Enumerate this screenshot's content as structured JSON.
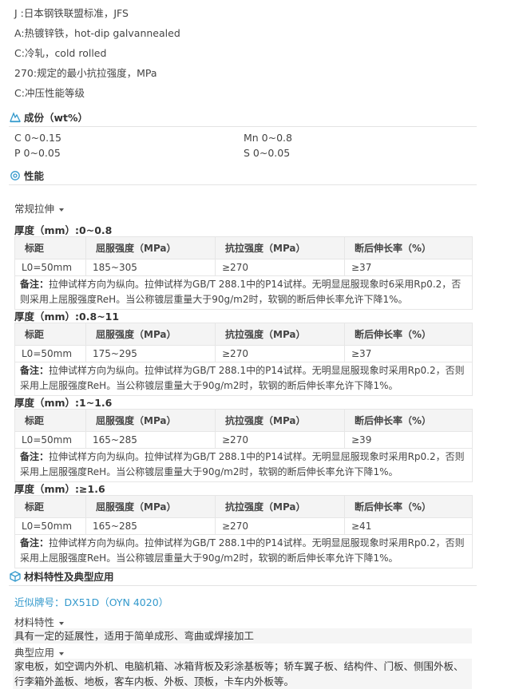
{
  "designation": [
    "J :日本钢铁联盟标准，JFS",
    "A:热镀锌铁，hot-dip galvannealed",
    "C:冷轧，cold rolled",
    "270:规定的最小抗拉强度，MPa",
    "C:冲压性能等级"
  ],
  "composition": {
    "title": "成份（wt%）",
    "items": [
      "C 0~0.15",
      "Mn 0~0.8",
      "P 0~0.05",
      "S 0~0.05"
    ]
  },
  "performance": {
    "title": "性能",
    "dropdown": "常规拉伸",
    "headers": [
      "标距",
      "屈服强度（MPa）",
      "抗拉强度（MPa）",
      "断后伸长率（%）"
    ],
    "note_label": "备注：",
    "note_text": "拉伸试样方向为纵向。拉伸试样为GB/T 288.1中的P14试样。无明显屈服现象时采用Rp0.2，否则采用上屈服强度ReH。当公称镀层重量大于90g/m2时，软钢的断后伸长率允许下降1%。",
    "groups": [
      {
        "thickness": "厚度（mm）:0~0.8",
        "row": [
          "L0=50mm",
          "185~305",
          "≥270",
          "≥37"
        ],
        "note_label": "备注：",
        "note_text": "拉伸试样方向为纵向。拉伸试样为GB/T 288.1中的P14试样。无明显屈服现象时6采用Rp0.2，否则采用上屈服强度ReH。当公称镀层重量大于90g/m2时，软钢的断后伸长率允许下降1%。"
      },
      {
        "thickness": "厚度（mm）:0.8~11",
        "row": [
          "L0=50mm",
          "175~295",
          "≥270",
          "≥37"
        ],
        "note_label": "备注：",
        "note_text": "拉伸试样方向为纵向。拉伸试样为GB/T 288.1中的P14试样。无明显屈服现象时采用Rp0.2，否则采用上屈服强度ReH。当公称镀层重量大于90g/m2时，软钢的断后伸长率允许下降1%。"
      },
      {
        "thickness": "厚度（mm）:1~1.6",
        "row": [
          "L0=50mm",
          "165~285",
          "≥270",
          "≥39"
        ],
        "note_label": "备注：",
        "note_text": "拉伸试样方向为纵向。拉伸试样为GB/T 288.1中的P14试样。无明显屈服现象时采用Rp0.2，否则采用上屈服强度ReH。当公称镀层重量大于90g/m2时，软钢的断后伸长率允许下降1%。"
      },
      {
        "thickness": "厚度（mm）:≥1.6",
        "row": [
          "L0=50mm",
          "165~285",
          "≥270",
          "≥41"
        ],
        "note_label": "备注：",
        "note_text": "拉伸试样方向为纵向。拉伸试样为GB/T 288.1中的P14试样。无明显屈服现象时采用Rp0.2，否则采用上屈服强度ReH。当公称镀层重量大于90g/m2时，软钢的断后伸长率允许下降1%。"
      }
    ]
  },
  "application": {
    "title": "材料特性及典型应用",
    "similar": "近似牌号：DX51D（OYN 4020）",
    "feature_label": "材料特性",
    "feature_text": "具有一定的延展性，适用于简单成形、弯曲或焊接加工",
    "usage_label": "典型应用",
    "usage_text": "家电板，如空调内外机、电脑机箱、冰箱背板及彩涂基板等；轿车翼子板、结构件、门板、侧围外板、行李箱外盖板、地板，客车内板、外板、顶板，卡车内外板等。"
  },
  "colors": {
    "accent": "#3399cc",
    "header_bg": "#f4f4f4",
    "border": "#e6e6e6"
  }
}
